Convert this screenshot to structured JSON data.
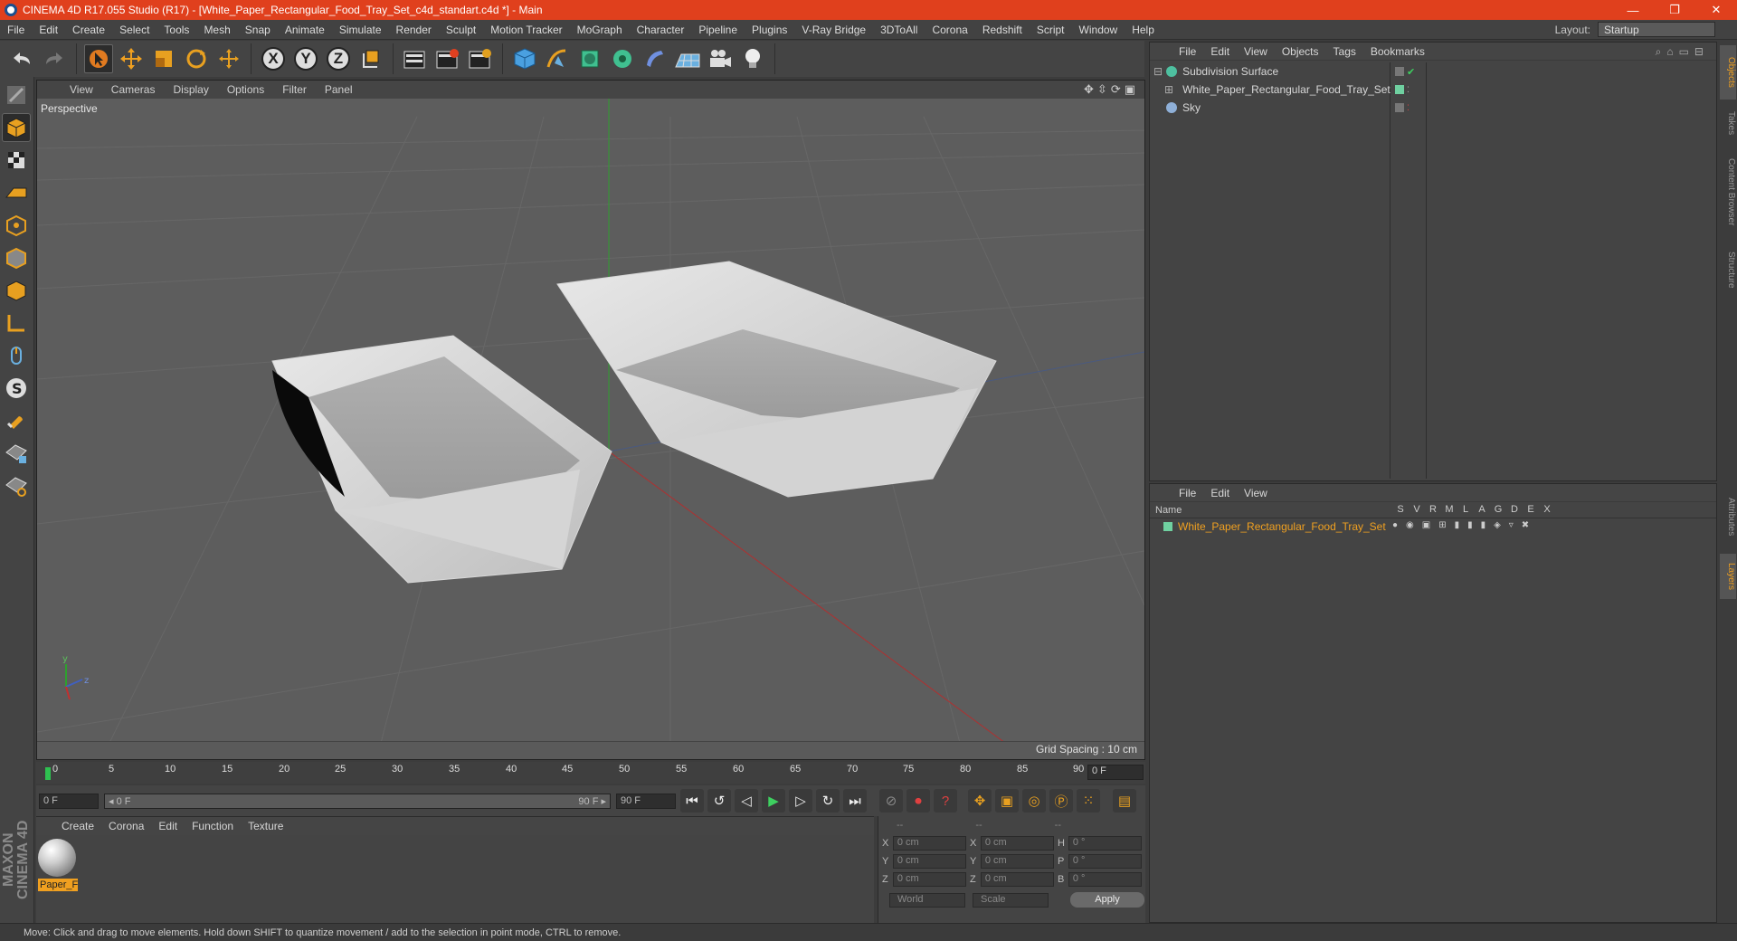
{
  "window": {
    "title": "CINEMA 4D R17.055 Studio (R17) - [White_Paper_Rectangular_Food_Tray_Set_c4d_standart.c4d *] - Main",
    "minimize": "—",
    "maximize": "❐",
    "close": "✕"
  },
  "menubar": {
    "items": [
      "File",
      "Edit",
      "Create",
      "Select",
      "Tools",
      "Mesh",
      "Snap",
      "Animate",
      "Simulate",
      "Render",
      "Sculpt",
      "Motion Tracker",
      "MoGraph",
      "Character",
      "Pipeline",
      "Plugins",
      "V-Ray Bridge",
      "3DToAll",
      "Corona",
      "Redshift",
      "Script",
      "Window",
      "Help"
    ],
    "layout_label": "Layout:",
    "layout_value": "Startup"
  },
  "viewport": {
    "menu": [
      "View",
      "Cameras",
      "Display",
      "Options",
      "Filter",
      "Panel"
    ],
    "label": "Perspective",
    "grid_spacing": "Grid Spacing : 10 cm"
  },
  "timeline": {
    "ticks": [
      "0",
      "5",
      "10",
      "15",
      "20",
      "25",
      "30",
      "35",
      "40",
      "45",
      "50",
      "55",
      "60",
      "65",
      "70",
      "75",
      "80",
      "85",
      "90"
    ],
    "current_frame": "0 F"
  },
  "playback": {
    "start": "0 F",
    "range_start": "◂ 0 F",
    "range_end": "90 F ▸",
    "end": "90 F"
  },
  "material_manager": {
    "menu": [
      "Create",
      "Corona",
      "Edit",
      "Function",
      "Texture"
    ],
    "materials": [
      {
        "name": "Paper_F"
      }
    ]
  },
  "coord_manager": {
    "headers": [
      "--",
      "--",
      "--"
    ],
    "rows": [
      {
        "a_label": "X",
        "a_val": "0 cm",
        "b_label": "X",
        "b_val": "0 cm",
        "c_label": "H",
        "c_val": "0 °"
      },
      {
        "a_label": "Y",
        "a_val": "0 cm",
        "b_label": "Y",
        "b_val": "0 cm",
        "c_label": "P",
        "c_val": "0 °"
      },
      {
        "a_label": "Z",
        "a_val": "0 cm",
        "b_label": "Z",
        "b_val": "0 cm",
        "c_label": "B",
        "c_val": "0 °"
      }
    ],
    "mode1": "World",
    "mode2": "Scale",
    "apply": "Apply"
  },
  "object_manager": {
    "menu": [
      "File",
      "Edit",
      "View",
      "Objects",
      "Tags",
      "Bookmarks"
    ],
    "objects": [
      {
        "name": "Subdivision Surface",
        "icon_color": "#4ec0a0"
      },
      {
        "name": "White_Paper_Rectangular_Food_Tray_Set",
        "icon_color": "#aaaaaa"
      },
      {
        "name": "Sky",
        "icon_color": "#8fb0d8"
      }
    ]
  },
  "layer_manager": {
    "menu": [
      "File",
      "Edit",
      "View"
    ],
    "name_header": "Name",
    "columns": [
      "S",
      "V",
      "R",
      "M",
      "L",
      "A",
      "G",
      "D",
      "E",
      "X"
    ],
    "layers": [
      {
        "name": "White_Paper_Rectangular_Food_Tray_Set",
        "color": "#6fd0a0"
      }
    ]
  },
  "side_tabs": [
    "Objects",
    "Takes",
    "Content Browser",
    "Structure",
    "Attributes",
    "Layers"
  ],
  "brand": "MAXON CINEMA 4D",
  "status": "Move: Click and drag to move elements. Hold down SHIFT to quantize movement / add to the selection in point mode, CTRL to remove.",
  "colors": {
    "accent": "#e0401d",
    "highlight": "#f0a020"
  }
}
